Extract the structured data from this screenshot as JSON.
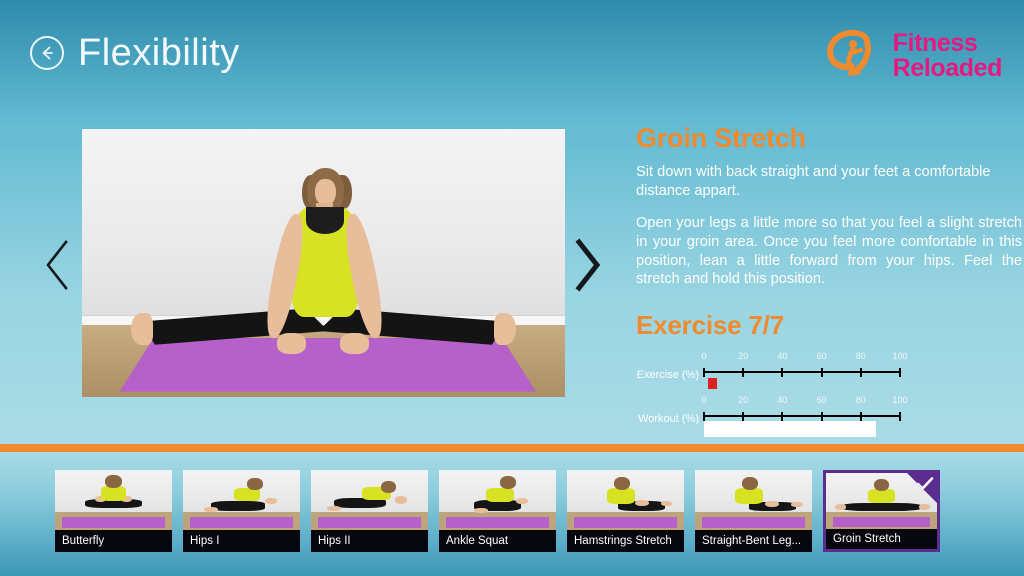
{
  "header": {
    "back_icon": "back-arrow-icon",
    "title": "Flexibility"
  },
  "brand": {
    "mark_icon": "fitness-reloaded-swoosh-logo",
    "line1": "Fitness",
    "line2": "Reloaded",
    "text_color": "#e5197f",
    "mark_color": "#f08a2e"
  },
  "viewer": {
    "prev_icon": "chevron-left-icon",
    "next_icon": "chevron-right-icon",
    "photo_alt": "woman-seated-groin-stretch-on-purple-mat"
  },
  "detail": {
    "exercise_name": "Groin Stretch",
    "paragraph1": "Sit down with back straight and your feet a comfortable distance appart.",
    "paragraph2": "Open your legs a little more so that you feel a slight stretch in your groin area. Once you feel more comfortable in this position, lean a little forward from your hips. Feel the stretch and hold this position.",
    "progress_heading": "Exercise 7/7",
    "accent_color": "#f08a2e"
  },
  "chart_data": {
    "type": "bar",
    "title": "Exercise 7/7",
    "xlabel": "",
    "ylabel": "",
    "xlim": [
      0,
      100
    ],
    "grid": false,
    "legend": "none",
    "ticks": [
      0,
      20,
      40,
      60,
      80,
      100
    ],
    "categories": [
      "Exercise (%)",
      "Workout (%)"
    ],
    "values": [
      2,
      88
    ],
    "series": [
      {
        "name": "Exercise (%)",
        "label": "Exercise (%)",
        "value": 2,
        "display": "marker",
        "color": "#e02020",
        "ticks": [
          0,
          20,
          40,
          60,
          80,
          100
        ]
      },
      {
        "name": "Workout (%)",
        "label": "Workout (%)",
        "value": 88,
        "display": "bar",
        "color": "#ffffff",
        "ticks": [
          0,
          20,
          40,
          60,
          80,
          100
        ]
      }
    ]
  },
  "thumbnails": {
    "selected_index": 6,
    "check_icon": "checkmark-icon",
    "selected_border_color": "#5c2d91",
    "items": [
      {
        "label": "Butterfly",
        "selected": false
      },
      {
        "label": "Hips I",
        "selected": false
      },
      {
        "label": "Hips II",
        "selected": false
      },
      {
        "label": "Ankle Squat",
        "selected": false
      },
      {
        "label": "Hamstrings Stretch",
        "selected": false
      },
      {
        "label": "Straight-Bent Leg...",
        "selected": false
      },
      {
        "label": "Groin Stretch",
        "selected": true
      }
    ]
  },
  "theme": {
    "background_top": "#2e8bab",
    "background_mid": "#9ad5e2",
    "divider_color": "#f08a2e"
  }
}
